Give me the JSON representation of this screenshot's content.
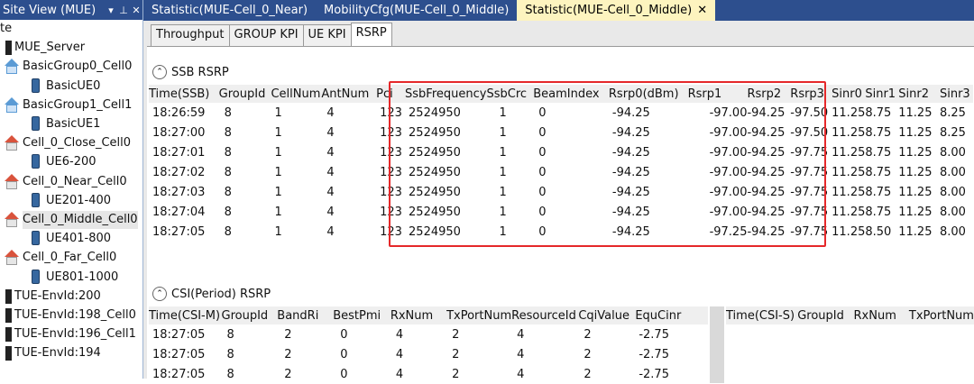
{
  "sidebar": {
    "title": "Site View (MUE)",
    "pin": "⬆",
    "pin2": "ฺ",
    "close": "✕",
    "items": [
      {
        "label": "te",
        "icon": "none"
      },
      {
        "label": "MUE_Server",
        "icon": "bar"
      },
      {
        "label": "BasicGroup0_Cell0",
        "icon": "house-blue"
      },
      {
        "label": "BasicUE0",
        "icon": "phone"
      },
      {
        "label": "BasicGroup1_Cell1",
        "icon": "house-blue"
      },
      {
        "label": "BasicUE1",
        "icon": "phone"
      },
      {
        "label": "Cell_0_Close_Cell0",
        "icon": "house"
      },
      {
        "label": "UE6-200",
        "icon": "phone"
      },
      {
        "label": "Cell_0_Near_Cell0",
        "icon": "house"
      },
      {
        "label": "UE201-400",
        "icon": "phone"
      },
      {
        "label": "Cell_0_Middle_Cell0",
        "icon": "house",
        "selected": true
      },
      {
        "label": "UE401-800",
        "icon": "phone"
      },
      {
        "label": "Cell_0_Far_Cell0",
        "icon": "house"
      },
      {
        "label": "UE801-1000",
        "icon": "phone"
      },
      {
        "label": "TUE-EnvId:200",
        "icon": "bar"
      },
      {
        "label": "TUE-EnvId:198_Cell0",
        "icon": "bar"
      },
      {
        "label": "TUE-EnvId:196_Cell1",
        "icon": "bar"
      },
      {
        "label": "TUE-EnvId:194",
        "icon": "bar"
      }
    ]
  },
  "doc_tabs": {
    "tab1": "Statistic(MUE-Cell_0_Near)",
    "tab2": "MobilityCfg(MUE-Cell_0_Middle)",
    "tab3": "Statistic(MUE-Cell_0_Middle)",
    "close": "✕"
  },
  "sub_tabs": [
    "Throughput",
    "GROUP KPI",
    "UE KPI",
    "RSRP"
  ],
  "ssb": {
    "title": "SSB RSRP",
    "collapse": "⌃",
    "headers": [
      "Time(SSB)",
      "GroupId",
      "CellNum",
      "AntNum",
      "Pci",
      "SsbFrequency",
      "SsbCrc",
      "BeamIndex",
      "Rsrp0(dBm)",
      "Rsrp1",
      "Rsrp2",
      "Rsrp3",
      "Sinr0",
      "Sinr1",
      "Sinr2",
      "Sinr3"
    ],
    "rows": [
      [
        "18:26:59",
        "8",
        "1",
        "4",
        "123",
        "2524950",
        "1",
        "0",
        "-94.25",
        "-97.00",
        "-94.25",
        "-97.50",
        "11.25",
        "8.75",
        "11.25",
        "8.25"
      ],
      [
        "18:27:00",
        "8",
        "1",
        "4",
        "123",
        "2524950",
        "1",
        "0",
        "-94.25",
        "-97.00",
        "-94.25",
        "-97.50",
        "11.25",
        "8.75",
        "11.25",
        "8.25"
      ],
      [
        "18:27:01",
        "8",
        "1",
        "4",
        "123",
        "2524950",
        "1",
        "0",
        "-94.25",
        "-97.00",
        "-94.25",
        "-97.75",
        "11.25",
        "8.75",
        "11.25",
        "8.00"
      ],
      [
        "18:27:02",
        "8",
        "1",
        "4",
        "123",
        "2524950",
        "1",
        "0",
        "-94.25",
        "-97.00",
        "-94.25",
        "-97.75",
        "11.25",
        "8.75",
        "11.25",
        "8.00"
      ],
      [
        "18:27:03",
        "8",
        "1",
        "4",
        "123",
        "2524950",
        "1",
        "0",
        "-94.25",
        "-97.00",
        "-94.25",
        "-97.75",
        "11.25",
        "8.75",
        "11.25",
        "8.00"
      ],
      [
        "18:27:04",
        "8",
        "1",
        "4",
        "123",
        "2524950",
        "1",
        "0",
        "-94.25",
        "-97.00",
        "-94.25",
        "-97.75",
        "11.25",
        "8.75",
        "11.25",
        "8.00"
      ],
      [
        "18:27:05",
        "8",
        "1",
        "4",
        "123",
        "2524950",
        "1",
        "0",
        "-94.25",
        "-97.25",
        "-94.25",
        "-97.75",
        "11.25",
        "8.50",
        "11.25",
        "8.00"
      ]
    ]
  },
  "csi": {
    "title": "CSI(Period) RSRP",
    "collapse": "⌃",
    "headers": [
      "Time(CSI-M)",
      "GroupId",
      "BandRi",
      "BestPmi",
      "RxNum",
      "TxPortNum",
      "ResourceId",
      "CqiValue",
      "EquCinr"
    ],
    "rows": [
      [
        "18:27:05",
        "8",
        "2",
        "0",
        "4",
        "2",
        "4",
        "2",
        "-2.75"
      ],
      [
        "18:27:05",
        "8",
        "2",
        "0",
        "4",
        "2",
        "4",
        "2",
        "-2.75"
      ],
      [
        "18:27:05",
        "8",
        "2",
        "0",
        "4",
        "2",
        "4",
        "2",
        "-2.75"
      ]
    ],
    "right_headers": [
      "Time(CSI-S)",
      "GroupId",
      "RxNum",
      "TxPortNum"
    ]
  }
}
